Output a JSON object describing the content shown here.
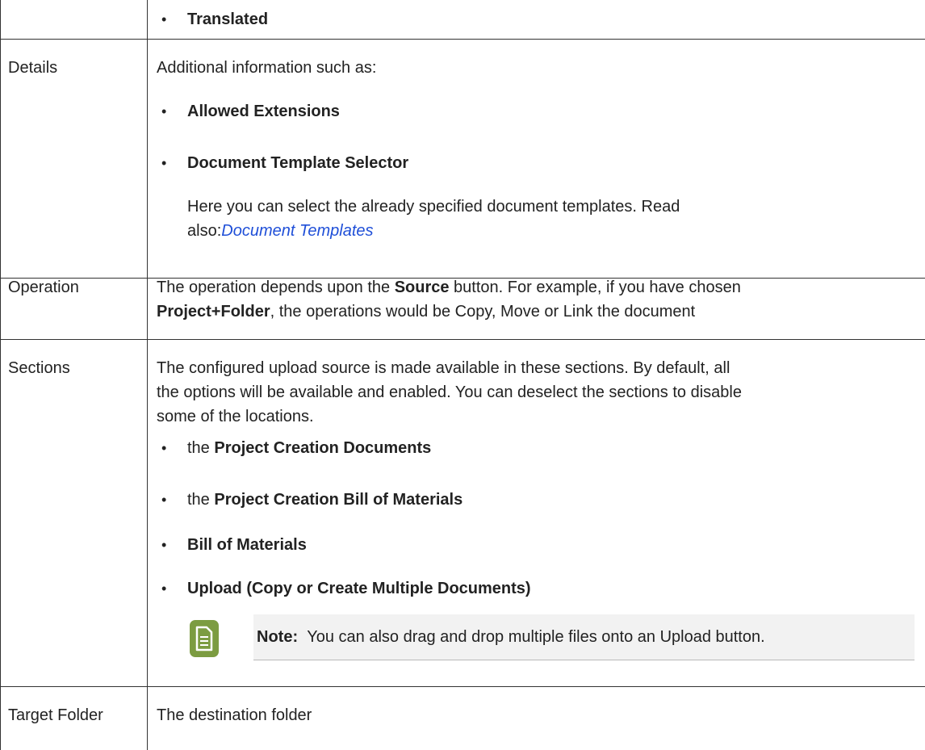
{
  "rows": [
    {
      "label": "",
      "bullets": [
        "Translated"
      ]
    },
    {
      "label": "Details",
      "intro": "Additional information such as:",
      "bullets": [
        "Allowed Extensions",
        "Document Template Selector"
      ],
      "para_line1": "Here you can select the already specified document templates. Read",
      "para_line2_prefix": "also:",
      "para_link": "Document Templates"
    },
    {
      "label": "Operation",
      "seg1": "The operation depends upon the ",
      "seg1_bold": "Source",
      "seg1_tail": " button. For example, if you have chosen",
      "seg2_bold": "Project+Folder",
      "seg2_tail": ", the operations would be Copy, Move or Link the document"
    },
    {
      "label": "Sections",
      "lines": [
        "The configured upload source is made available in these sections. By default, all",
        "the options will be available and enabled. You can deselect the sections to disable",
        "some of the locations."
      ],
      "items": [
        {
          "prefix": "the ",
          "bold": "Project Creation Documents"
        },
        {
          "prefix": "the ",
          "bold": "Project Creation Bill of Materials"
        },
        {
          "prefix": "",
          "bold": "Bill of Materials"
        },
        {
          "prefix": "",
          "bold": "Upload (Copy or Create Multiple Documents)"
        }
      ],
      "note_label": "Note:",
      "note_text": "You can also drag and drop multiple files onto an Upload button."
    },
    {
      "label": "Target Folder",
      "text": "The destination folder"
    }
  ],
  "colors": {
    "link": "#1f4fd8",
    "note_icon": "#7c9c41",
    "note_bg": "#f2f2f2"
  },
  "icons": {
    "note": "note-icon"
  }
}
